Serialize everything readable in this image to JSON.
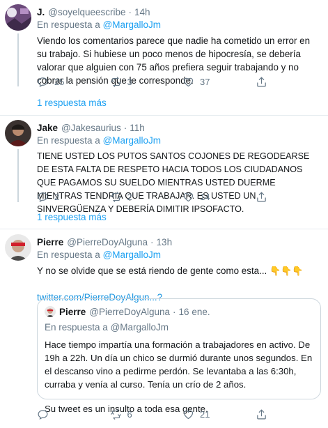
{
  "tweets": [
    {
      "name": "J.",
      "handle": "@soyelqueescribe",
      "separator": "·",
      "time": "14h",
      "reply_prefix": "En respuesta a",
      "reply_mention": "@MargalloJm",
      "text": "Viendo los comentarios parece que nadie ha cometido un error en su trabajo. Si hubiese un poco menos de hipocresía, se debería valorar que alguien con 75 años prefiera seguir trabajando y no cobrar la pensión que le corresponde.",
      "replies": "25",
      "retweets": "3",
      "likes": "37",
      "more_replies": "1 respuesta más"
    },
    {
      "name": "Jake",
      "handle": "@Jakesaurius",
      "separator": "·",
      "time": "11h",
      "reply_prefix": "En respuesta a",
      "reply_mention": "@MargalloJm",
      "text": "TIENE USTED LOS PUTOS SANTOS COJONES DE REGODEARSE DE ESTA FALTA DE RESPETO HACIA TODOS LOS CIUDADANOS QUE PAGAMOS SU SUELDO MIENTRAS USTED DUERME MIENTRAS TENDRIA QUE TRABAJAR. ES USTED UN SINVERGÜENZA Y DEBERÍA DIMITIR IPSOFACTO.",
      "replies": "2",
      "retweets": "2",
      "likes": "14",
      "more_replies": "1 respuesta más"
    },
    {
      "name": "Pierre",
      "handle": "@PierreDoyAlguna",
      "separator": "·",
      "time": "13h",
      "reply_prefix": "En respuesta a",
      "reply_mention": "@MargalloJm",
      "text": "Y no se olvide que se está riendo de gente como esta...",
      "emojis": "👇👇👇",
      "link": "twitter.com/PierreDoyAlgun...?",
      "replies": "",
      "retweets": "6",
      "likes": "21",
      "quote": {
        "name": "Pierre",
        "handle": "@PierreDoyAlguna",
        "separator": "·",
        "time": "16 ene.",
        "reply_prefix": "En respuesta a",
        "reply_mention": "@MargalloJm",
        "text": "Hace tiempo impartía una formación a trabajadores en activo. De 19h a 22h. Un día un chico se durmió durante unos segundos. En el descanso vino a pedirme perdón. Se levantaba a las 6:30h, curraba y venía al curso. Tenía un crío de 2 años.",
        "text2": "Su tweet es un insulto a toda esa gente."
      }
    }
  ],
  "colors": {
    "accent": "#1da1f2",
    "secondary_text": "#657786",
    "border": "#e6ecf0"
  },
  "icons": [
    "reply-icon",
    "retweet-icon",
    "like-icon",
    "share-icon"
  ]
}
